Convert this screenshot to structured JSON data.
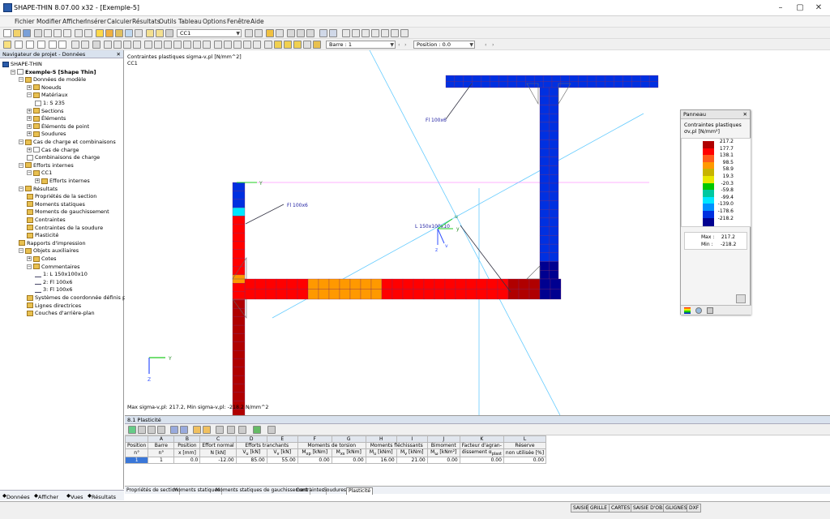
{
  "window": {
    "title": "SHAPE-THIN 8.07.00 x32 - [Exemple-5]"
  },
  "menu": [
    "Fichier",
    "Modifier",
    "Afficher",
    "Insérer",
    "Calculer",
    "Résultats",
    "Outils",
    "Tableau",
    "Options",
    "Fenêtre",
    "Aide"
  ],
  "toolbar": {
    "loadcase": "CC1",
    "bar": "Barre : 1",
    "position": "Position : 0.0"
  },
  "navigator": {
    "title": "Navigateur de projet - Données",
    "items": [
      "SHAPE-THIN",
      "Exemple-5 [Shape Thin]",
      "Données de modèle",
      "Noeuds",
      "Matériaux",
      "1: S 235",
      "Sections",
      "Éléments",
      "Éléments de point",
      "Soudures",
      "Cas de charge et combinaisons",
      "Cas de charge",
      "Combinaisons de charge",
      "Efforts internes",
      "CC1",
      "Efforts internes",
      "Résultats",
      "Propriétés de la section",
      "Moments statiques",
      "Moments de gauchissement",
      "Contraintes",
      "Contraintes de la soudure",
      "Plasticité",
      "Rapports d'impression",
      "Objets auxiliaires",
      "Cotes",
      "Commentaires",
      "1: L 150x100x10",
      "2: Fl 100x6",
      "3: Fl 100x6",
      "Systèmes de coordonnée définis par l",
      "Lignes directrices",
      "Couches d'arrière-plan"
    ],
    "tabs": [
      "Données",
      "Afficher",
      "Vues",
      "Résultats"
    ]
  },
  "canvas": {
    "header1": "Contraintes plastiques sigma-v,pl [N/mm^2]",
    "header2": "CC1",
    "footer": "Max sigma-v,pl: 217.2, Min sigma-v,pl: -218.2 N/mm^2",
    "labels": {
      "fl_top": "Fl 100x6",
      "fl_left": "Fl 100x6",
      "angle": "L 150x100x10"
    },
    "axes": {
      "y": "Y",
      "z": "Z",
      "y2": "y",
      "z2": "z",
      "u": "u",
      "v": "v"
    }
  },
  "panel": {
    "title": "Panneau",
    "subtitle": "Contraintes plastiques",
    "unit": "σv,pl [N/mm²]",
    "levels": [
      "217.2",
      "177.7",
      "138.1",
      "98.5",
      "58.9",
      "19.3",
      "-20.3",
      "-59.8",
      "-99.4",
      "-139.0",
      "-178.6",
      "-218.2"
    ],
    "colors": [
      "#b00000",
      "#ff0000",
      "#ff5a1a",
      "#ff9900",
      "#c8b400",
      "#e8e800",
      "#00c800",
      "#00c8a0",
      "#00e6ff",
      "#0090ff",
      "#0030e0",
      "#000090"
    ],
    "max_label": "Max  :",
    "max_value": "217.2",
    "min_label": "Min  :",
    "min_value": "-218.2"
  },
  "results": {
    "title": "8.1 Plasticité",
    "col_letters": [
      "A",
      "B",
      "C",
      "D",
      "E",
      "F",
      "G",
      "H",
      "I",
      "J",
      "K",
      "L"
    ],
    "row_no": "1",
    "cells": [
      "1",
      "0.0",
      "-12.00",
      "85.00",
      "55.00",
      "0.00",
      "0.00",
      "16.00",
      "21.00",
      "0.00",
      "0.00",
      "0.00"
    ],
    "tabs": [
      "Propriétés de section",
      "Moments statiques",
      "Moments statiques de gauchissement",
      "Contraintes",
      "Soudures",
      "Plasticité"
    ]
  },
  "statusbar": [
    "SAISIE",
    "GRILLE",
    "CARTES",
    "SAISIE D'OB.",
    "GLIGNES",
    "DXF"
  ]
}
